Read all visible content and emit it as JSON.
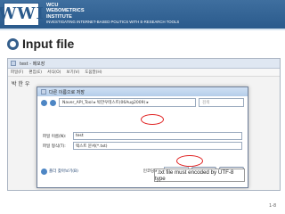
{
  "header": {
    "logo_text": "WWI",
    "org_line1": "WCU",
    "org_line2": "WEBOMETRICS",
    "org_line3": "INSTITUTE",
    "tagline": "INVESTIGATING INTERNET-BASED POLITICS WITH E-RESEARCH TOOLS"
  },
  "slide": {
    "title": "Input file",
    "page_number": "1-8"
  },
  "editor": {
    "app_title": "test - 메모장",
    "menu": [
      "파일(F)",
      "편집(E)",
      "서식(O)",
      "보기(V)",
      "도움말(H)"
    ],
    "content": "박 한 우"
  },
  "dialog": {
    "title": "다른 이름으로 저장",
    "path": "Naver_API_Tool ▸ 박한우테스트(06Aug2009) ▸",
    "search_placeholder": "검색",
    "filename_label": "파일 이름(N):",
    "filename_value": "test",
    "filetype_label": "파일 형식(T):",
    "filetype_value": "텍스트 문서(*.txt)",
    "hide_folders": "폴더 찾아보기(B)",
    "encoding_label": "인코딩(E):",
    "encoding_value": "UTF-8",
    "save_label": "저장(S)",
    "cancel_label": "취소"
  },
  "callout_text": "*.txt file must encoded by UTF-8 type",
  "colors": {
    "banner": "#2a5a8c",
    "highlight": "#e02020"
  }
}
